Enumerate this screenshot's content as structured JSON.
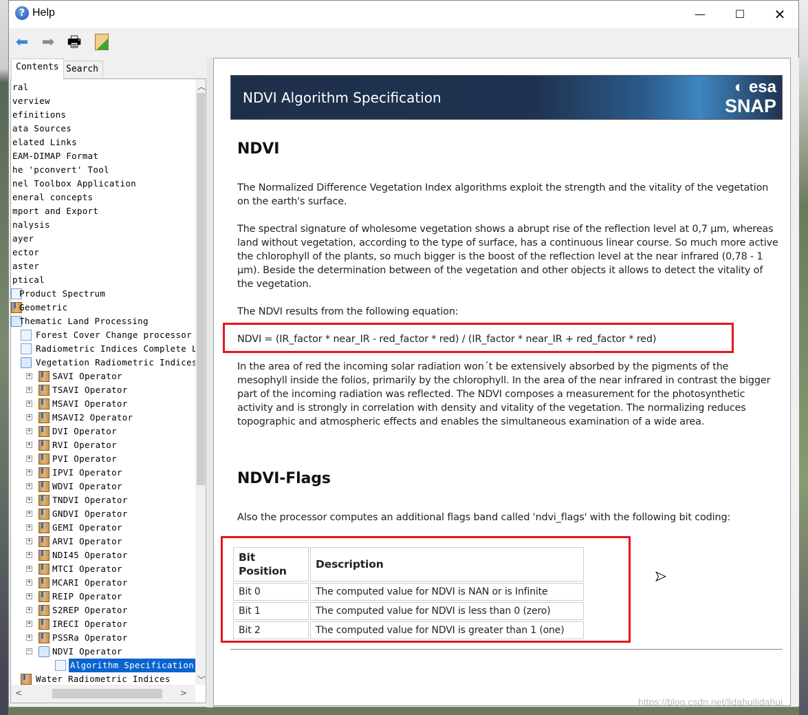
{
  "window": {
    "title": "Help",
    "icon": "help-question-icon",
    "controls": [
      "minimize",
      "maximize",
      "close"
    ]
  },
  "toolbar": {
    "buttons": [
      {
        "name": "back",
        "icon": "arrow-left-icon"
      },
      {
        "name": "forward",
        "icon": "arrow-right-icon"
      },
      {
        "name": "print",
        "icon": "printer-icon"
      },
      {
        "name": "page-setup",
        "icon": "page-setup-icon"
      }
    ]
  },
  "tabs": [
    {
      "label": "Contents",
      "active": true
    },
    {
      "label": "Search",
      "active": false
    }
  ],
  "tree": [
    {
      "label": "ral",
      "level": 0,
      "icon": "none"
    },
    {
      "label": "verview",
      "level": 0,
      "icon": "none"
    },
    {
      "label": "efinitions",
      "level": 0,
      "icon": "none"
    },
    {
      "label": "ata Sources",
      "level": 0,
      "icon": "none"
    },
    {
      "label": "elated Links",
      "level": 0,
      "icon": "none"
    },
    {
      "label": "EAM-DIMAP Format",
      "level": 0,
      "icon": "none"
    },
    {
      "label": "he 'pconvert' Tool",
      "level": 0,
      "icon": "none"
    },
    {
      "label": "nel Toolbox Application",
      "level": 0,
      "icon": "none"
    },
    {
      "label": "eneral concepts",
      "level": 0,
      "icon": "none"
    },
    {
      "label": "mport and Export",
      "level": 0,
      "icon": "none"
    },
    {
      "label": "nalysis",
      "level": 0,
      "icon": "none"
    },
    {
      "label": "ayer",
      "level": 0,
      "icon": "none"
    },
    {
      "label": "ector",
      "level": 0,
      "icon": "none"
    },
    {
      "label": "aster",
      "level": 0,
      "icon": "none"
    },
    {
      "label": "ptical",
      "level": 0,
      "icon": "none"
    },
    {
      "label": "Product Spectrum",
      "level": 1,
      "icon": "page"
    },
    {
      "label": "Geometric",
      "level": 1,
      "icon": "book"
    },
    {
      "label": "Thematic Land Processing",
      "level": 1,
      "icon": "openbook"
    },
    {
      "label": "Forest Cover Change processor",
      "level": 2,
      "icon": "page"
    },
    {
      "label": "Radiometric Indices Complete L",
      "level": 2,
      "icon": "page"
    },
    {
      "label": "Vegetation Radiometric Indices",
      "level": 2,
      "icon": "openbook",
      "toggle": "-"
    },
    {
      "label": "SAVI Operator",
      "level": 3,
      "icon": "book",
      "toggle": "+"
    },
    {
      "label": "TSAVI Operator",
      "level": 3,
      "icon": "book",
      "toggle": "+"
    },
    {
      "label": "MSAVI Operator",
      "level": 3,
      "icon": "book",
      "toggle": "+"
    },
    {
      "label": "MSAVI2 Operator",
      "level": 3,
      "icon": "book",
      "toggle": "+"
    },
    {
      "label": "DVI Operator",
      "level": 3,
      "icon": "book",
      "toggle": "+"
    },
    {
      "label": "RVI Operator",
      "level": 3,
      "icon": "book",
      "toggle": "+"
    },
    {
      "label": "PVI Operator",
      "level": 3,
      "icon": "book",
      "toggle": "+"
    },
    {
      "label": "IPVI Operator",
      "level": 3,
      "icon": "book",
      "toggle": "+"
    },
    {
      "label": "WDVI Operator",
      "level": 3,
      "icon": "book",
      "toggle": "+"
    },
    {
      "label": "TNDVI Operator",
      "level": 3,
      "icon": "book",
      "toggle": "+"
    },
    {
      "label": "GNDVI Operator",
      "level": 3,
      "icon": "book",
      "toggle": "+"
    },
    {
      "label": "GEMI Operator",
      "level": 3,
      "icon": "book",
      "toggle": "+"
    },
    {
      "label": "ARVI Operator",
      "level": 3,
      "icon": "book",
      "toggle": "+"
    },
    {
      "label": "NDI45 Operator",
      "level": 3,
      "icon": "book",
      "toggle": "+"
    },
    {
      "label": "MTCI Operator",
      "level": 3,
      "icon": "book",
      "toggle": "+"
    },
    {
      "label": "MCARI Operator",
      "level": 3,
      "icon": "book",
      "toggle": "+"
    },
    {
      "label": "REIP Operator",
      "level": 3,
      "icon": "book",
      "toggle": "+"
    },
    {
      "label": "S2REP Operator",
      "level": 3,
      "icon": "book",
      "toggle": "+"
    },
    {
      "label": "IRECI Operator",
      "level": 3,
      "icon": "book",
      "toggle": "+"
    },
    {
      "label": "PSSRa Operator",
      "level": 3,
      "icon": "book",
      "toggle": "+"
    },
    {
      "label": "NDVI Operator",
      "level": 3,
      "icon": "openbook",
      "toggle": "-"
    },
    {
      "label": "Algorithm Specification",
      "level": 4,
      "icon": "page",
      "selected": true
    },
    {
      "label": "Water Radiometric Indices",
      "level": 2,
      "icon": "book",
      "toggle": "+"
    }
  ],
  "banner": {
    "title": "NDVI Algorithm Specification",
    "logo_top": "esa",
    "logo_bottom": "SNAP"
  },
  "doc": {
    "heading1": "NDVI",
    "p1": "The Normalized Difference Vegetation Index algorithms exploit the strength and the vitality of the vegetation on the earth's surface.",
    "p2": "The spectral signature of wholesome vegetation shows a abrupt rise of the reflection level at 0,7 µm, whereas land without vegetation, according to the type of surface, has a continuous linear course. So much more active the chlorophyll of the plants, so much bigger is the boost of the reflection level at the near infrared (0,78 - 1 µm). Beside the determination between of the vegetation and other objects it allows to detect the vitality of the vegetation.",
    "p3": "The NDVI results from the following equation:",
    "equation": "NDVI = (IR_factor * near_IR - red_factor * red) / (IR_factor * near_IR + red_factor * red)",
    "p4": "In the area of red the incoming solar radiation won´t be extensively absorbed by the pigments of the mesophyll inside the folios, primarily by the chlorophyll. In the area of the near infrared in contrast the bigger part of the incoming radiation was reflected. The NDVI composes a measurement for the photosynthetic activity and is strongly in correlation with density and vitality of the vegetation. The normalizing reduces topographic and atmospheric effects and enables the simultaneous examination of a wide area.",
    "heading2": "NDVI-Flags",
    "p5": "Also the processor computes an additional flags band called 'ndvi_flags' with the following bit coding:",
    "table": {
      "headers": [
        "Bit Position",
        "Description"
      ],
      "rows": [
        [
          "Bit 0",
          "The computed value for NDVI is NAN or is Infinite"
        ],
        [
          "Bit 1",
          "The computed value for NDVI is less than 0 (zero)"
        ],
        [
          "Bit 2",
          "The computed value for NDVI is greater than 1 (one)"
        ]
      ]
    }
  },
  "highlight_color": "#e8141a",
  "watermark": "https://blog.csdn.net/lidahuilidahui"
}
